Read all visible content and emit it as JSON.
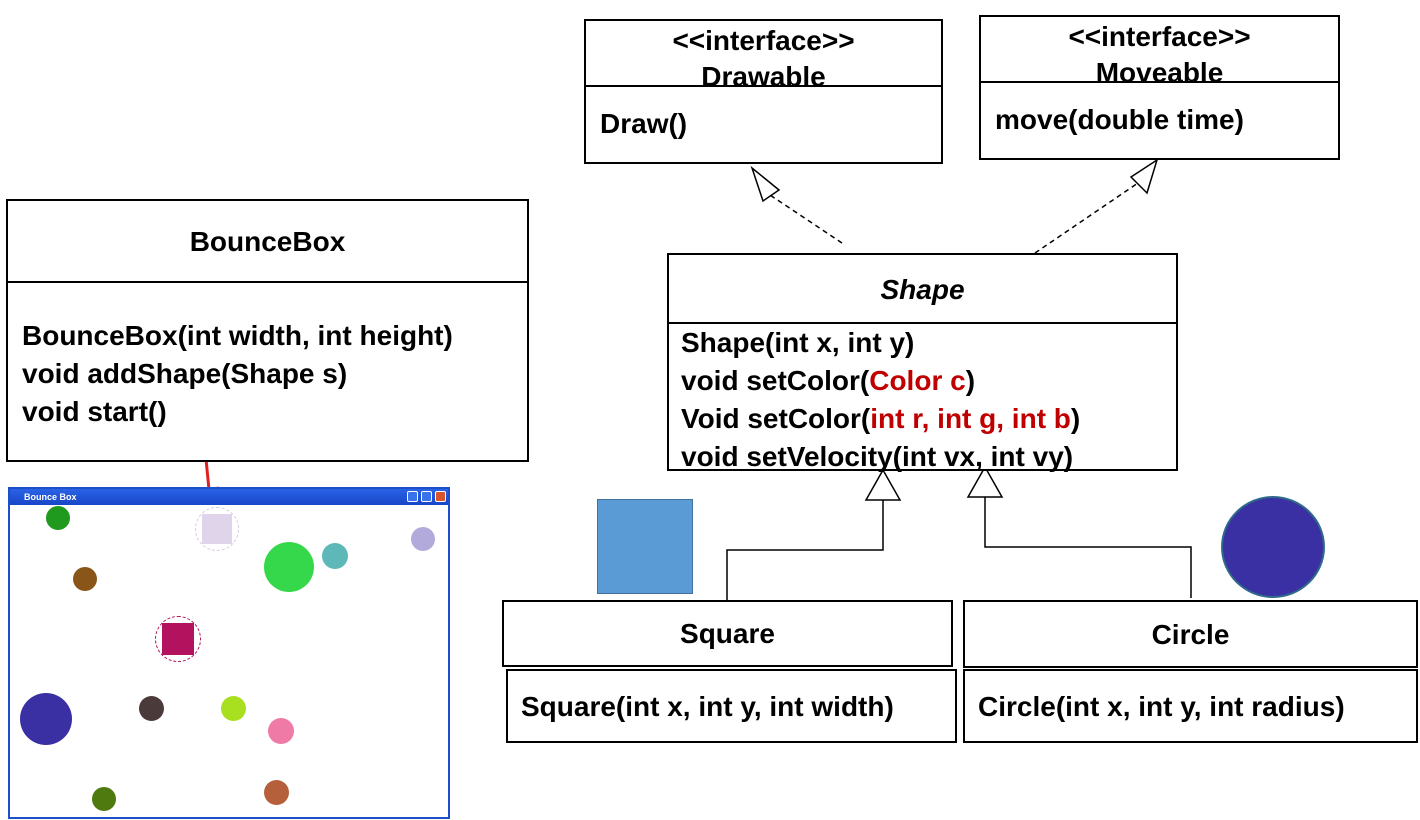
{
  "interfaces": [
    {
      "stereotype": "<<interface>>",
      "name": "Drawable",
      "method": "Draw()"
    },
    {
      "stereotype": "<<interface>>",
      "name": "Moveable",
      "method": "move(double time)"
    }
  ],
  "bouncebox": {
    "name": "BounceBox",
    "methods": [
      "BounceBox(int width, int height)",
      "void addShape(Shape s)",
      "void start()"
    ]
  },
  "shape": {
    "name": "Shape",
    "methods": {
      "m1": "Shape(int x, int y)",
      "m2_prefix": "void setColor(",
      "m2_param": "Color c",
      "m2_suffix": ")",
      "m3_prefix": "Void setColor(",
      "m3_param": "int r, int g, int b",
      "m3_suffix": ")",
      "m4": "void setVelocity(int vx, int vy)"
    }
  },
  "square": {
    "name": "Square",
    "method": "Square(int x, int y, int width)"
  },
  "circle": {
    "name": "Circle",
    "method": "Circle(int x, int y, int radius)"
  },
  "window": {
    "title": "Bounce Box"
  },
  "colors": {
    "param_red": "#c00000",
    "square_icon": "#5b9bd5",
    "circle_icon": "#3a2fa3",
    "window_border": "#1d4fc9",
    "arrow": "#e02020"
  },
  "window_shapes": [
    {
      "kind": "circle",
      "color": "#1f9a1f"
    },
    {
      "kind": "square",
      "color": "#e0d4ea"
    },
    {
      "kind": "circle",
      "color": "#b3aadc"
    },
    {
      "kind": "circle",
      "color": "#35d84a"
    },
    {
      "kind": "circle",
      "color": "#5fb8b8"
    },
    {
      "kind": "circle",
      "color": "#8a5518"
    },
    {
      "kind": "square",
      "color": "#b3125e"
    },
    {
      "kind": "circle",
      "color": "#3a2fa3"
    },
    {
      "kind": "circle",
      "color": "#4a3a3a"
    },
    {
      "kind": "circle",
      "color": "#a8e020"
    },
    {
      "kind": "circle",
      "color": "#f07aa6"
    },
    {
      "kind": "circle",
      "color": "#4f7a10"
    },
    {
      "kind": "circle",
      "color": "#b5603a"
    }
  ]
}
